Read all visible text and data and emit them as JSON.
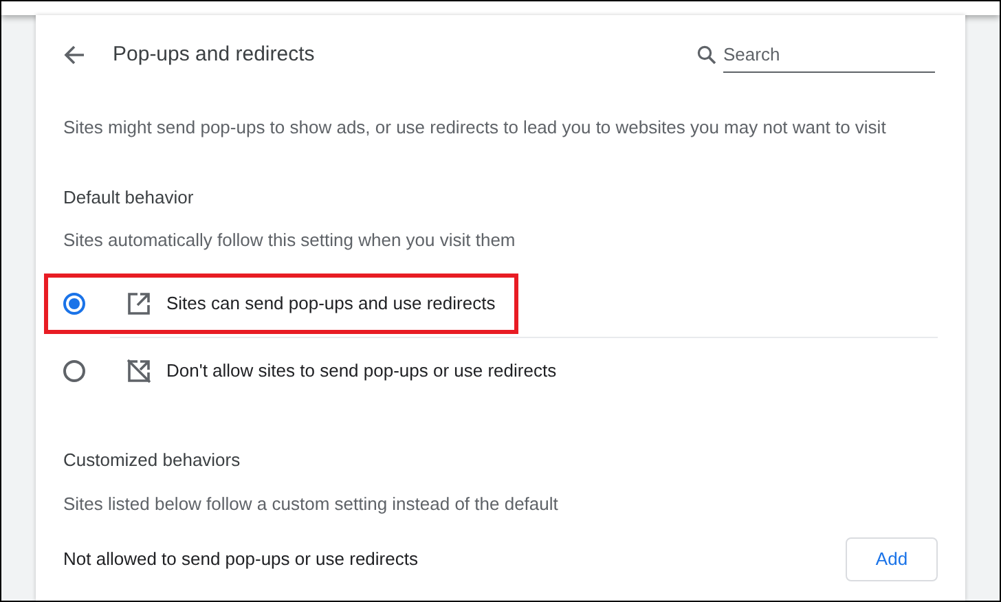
{
  "header": {
    "title": "Pop-ups and redirects",
    "search": {
      "placeholder": "Search"
    }
  },
  "description": "Sites might send pop-ups to show ads, or use redirects to lead you to websites you may not want to visit",
  "default_behavior": {
    "heading": "Default behavior",
    "subtitle": "Sites automatically follow this setting when you visit them",
    "options": [
      {
        "label": "Sites can send pop-ups and use redirects",
        "kind": "allow",
        "selected": true,
        "highlighted": true
      },
      {
        "label": "Don't allow sites to send pop-ups or use redirects",
        "kind": "block",
        "selected": false,
        "highlighted": false
      }
    ]
  },
  "customized_behaviors": {
    "heading": "Customized behaviors",
    "subtitle": "Sites listed below follow a custom setting instead of the default",
    "lists": [
      {
        "label": "Not allowed to send pop-ups or use redirects",
        "button": "Add"
      }
    ]
  }
}
